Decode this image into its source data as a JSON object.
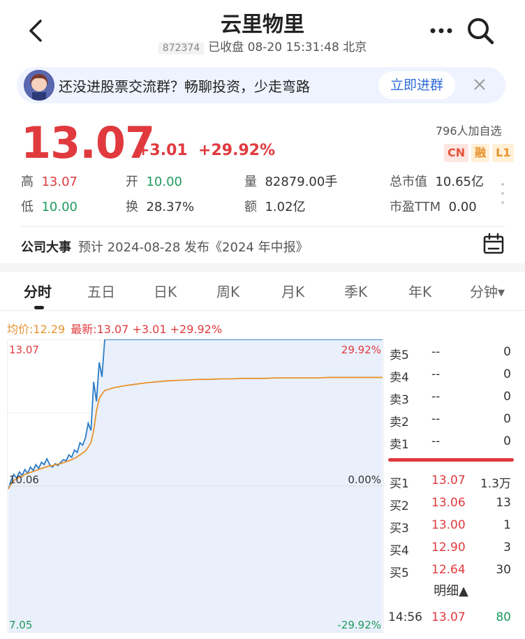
{
  "header": {
    "title": "云里物里",
    "code": "872374",
    "status": "已收盘 08-20 15:31:48 北京"
  },
  "banner": {
    "text": "还没进股票交流群？畅聊投资，少走弯路",
    "join_label": "立即进群"
  },
  "quote": {
    "price": "13.07",
    "change": "+3.01",
    "change_pct": "+29.92%",
    "followers": "796人加自选",
    "tags": [
      "CN",
      "融",
      "L1"
    ]
  },
  "stats": {
    "high_label": "高",
    "high": "13.07",
    "open_label": "开",
    "open": "10.00",
    "volume_label": "量",
    "volume": "82879.00手",
    "mcap_label": "总市值",
    "mcap": "10.65亿",
    "low_label": "低",
    "low": "10.00",
    "turnover_label": "换",
    "turnover": "28.37%",
    "amount_label": "额",
    "amount": "1.02亿",
    "pe_label": "市盈TTM",
    "pe": "0.00"
  },
  "event": {
    "label": "公司大事",
    "text": "预计 2024-08-28 发布《2024 年中报》"
  },
  "tabs": [
    "分时",
    "五日",
    "日K",
    "周K",
    "月K",
    "季K",
    "年K",
    "分钟▾"
  ],
  "info_line": {
    "avg": "均价:12.29",
    "latest": "最新:13.07 +3.01 +29.92%"
  },
  "chart_data": {
    "type": "line",
    "y_top_label": "13.07",
    "y_mid_label": "10.06",
    "y_bottom_label": "7.05",
    "pct_top_label": "29.92%",
    "pct_mid_label": "0.00%",
    "pct_bottom_label": "-29.92%",
    "ylim": [
      7.05,
      13.07
    ],
    "series": [
      {
        "color": "#2c7cc5",
        "values": [
          10.0,
          10.18,
          10.3,
          10.22,
          10.35,
          10.28,
          10.4,
          10.32,
          10.45,
          10.38,
          10.5,
          10.42,
          10.55,
          10.5,
          10.62,
          10.5,
          10.45,
          10.52,
          10.48,
          10.55,
          10.6,
          10.58,
          10.7,
          10.65,
          10.8,
          10.75,
          10.95,
          10.9,
          11.05,
          11.35,
          11.2,
          12.2,
          11.8,
          12.6,
          12.3,
          13.07,
          13.07,
          13.07,
          13.07,
          13.07,
          13.07,
          13.07,
          13.07,
          13.07,
          13.07,
          13.07,
          13.07,
          13.07,
          13.07,
          13.07,
          13.07,
          13.07,
          13.07,
          13.07,
          13.07,
          13.07,
          13.07,
          13.07,
          13.07,
          13.07,
          13.07,
          13.07
        ]
      },
      {
        "color": "#e8922e",
        "values": [
          10.0,
          10.1,
          10.18,
          10.2,
          10.24,
          10.26,
          10.3,
          10.32,
          10.34,
          10.36,
          10.38,
          10.4,
          10.42,
          10.44,
          10.46,
          10.47,
          10.48,
          10.5,
          10.51,
          10.52,
          10.54,
          10.56,
          10.58,
          10.6,
          10.63,
          10.66,
          10.7,
          10.74,
          10.78,
          10.86,
          10.95,
          11.2,
          11.6,
          11.85,
          11.95,
          12.02,
          12.08,
          12.12,
          12.15,
          12.18,
          12.2,
          12.22,
          12.23,
          12.24,
          12.25,
          12.25,
          12.26,
          12.26,
          12.27,
          12.27,
          12.27,
          12.28,
          12.28,
          12.28,
          12.28,
          12.28,
          12.29,
          12.29,
          12.29,
          12.29,
          12.29,
          12.29
        ]
      }
    ]
  },
  "orderbook": {
    "asks": [
      {
        "label": "卖5",
        "price": "--",
        "vol": "0"
      },
      {
        "label": "卖4",
        "price": "--",
        "vol": "0"
      },
      {
        "label": "卖3",
        "price": "--",
        "vol": "0"
      },
      {
        "label": "卖2",
        "price": "--",
        "vol": "0"
      },
      {
        "label": "卖1",
        "price": "--",
        "vol": "0"
      }
    ],
    "bids": [
      {
        "label": "买1",
        "price": "13.07",
        "vol": "1.3万"
      },
      {
        "label": "买2",
        "price": "13.06",
        "vol": "13"
      },
      {
        "label": "买3",
        "price": "13.00",
        "vol": "1"
      },
      {
        "label": "买4",
        "price": "12.90",
        "vol": "3"
      },
      {
        "label": "买5",
        "price": "12.64",
        "vol": "30"
      }
    ],
    "detail_label": "明细▲",
    "tick": {
      "time": "14:56",
      "price": "13.07",
      "vol": "80"
    }
  },
  "colors": {
    "up": "#e03a3e",
    "down": "#1e9a5e",
    "price_line": "#2c7cc5",
    "avg_line": "#e8922e",
    "accent": "#2f6bd8"
  }
}
